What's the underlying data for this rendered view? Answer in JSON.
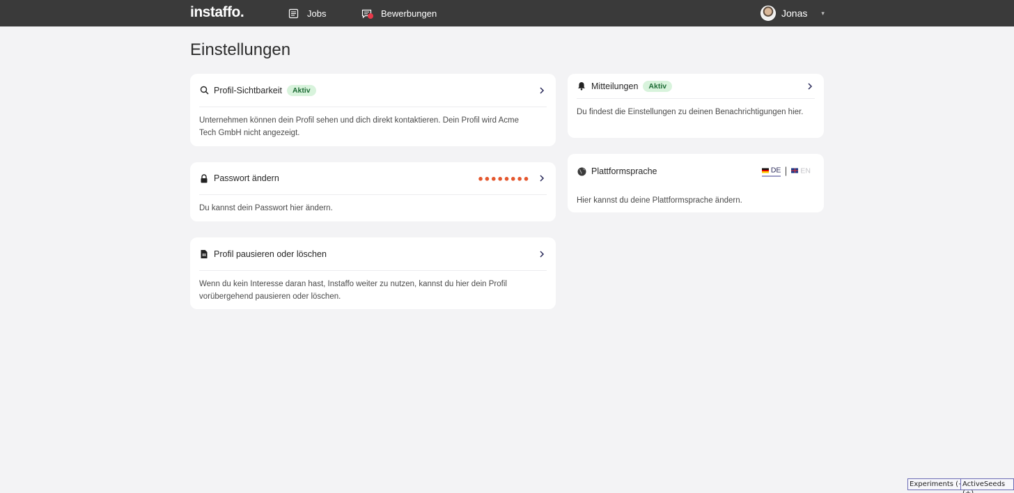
{
  "header": {
    "logo": "instaffo.",
    "nav": [
      {
        "label": "Jobs",
        "icon": "document-list-icon"
      },
      {
        "label": "Bewerbungen",
        "icon": "chat-icon",
        "notification": true
      }
    ],
    "user": {
      "name": "Jonas",
      "avatar": "avatar"
    }
  },
  "page": {
    "title": "Einstellungen"
  },
  "cards": {
    "visibility": {
      "title": "Profil-Sichtbarkeit",
      "badge": "Aktiv",
      "icon": "search-icon",
      "body": "Unternehmen können dein Profil sehen und dich direkt kontaktieren. Dein Profil wird Acme Tech GmbH nicht angezeigt."
    },
    "password": {
      "title": "Passwort ändern",
      "icon": "lock-icon",
      "masked": "●●●●●●●●",
      "body": "Du kannst dein Passwort hier ändern."
    },
    "pause": {
      "title": "Profil pausieren oder löschen",
      "icon": "file-pause-icon",
      "body": "Wenn du kein Interesse daran hast, Instaffo weiter zu nutzen, kannst du hier dein Profil vorübergehend pausieren oder löschen."
    },
    "notifications": {
      "title": "Mitteilungen",
      "badge": "Aktiv",
      "icon": "bell-icon",
      "body": "Du findest die Einstellungen zu deinen Benachrichtigungen hier."
    },
    "language": {
      "title": "Plattformsprache",
      "icon": "globe-icon",
      "options": [
        {
          "code": "DE",
          "selected": true
        },
        {
          "code": "EN",
          "selected": false
        }
      ],
      "body": "Hier kannst du deine Plattformsprache ändern."
    }
  },
  "debug": {
    "experiments": "Experiments (+)",
    "seeds": "ActiveSeeds (+)"
  },
  "colors": {
    "topbar": "#3a3a3a",
    "background": "#f3f3f5",
    "badge_bg": "#d8f3dc",
    "badge_text": "#1d6b35",
    "password_dots": "#e4572e"
  }
}
